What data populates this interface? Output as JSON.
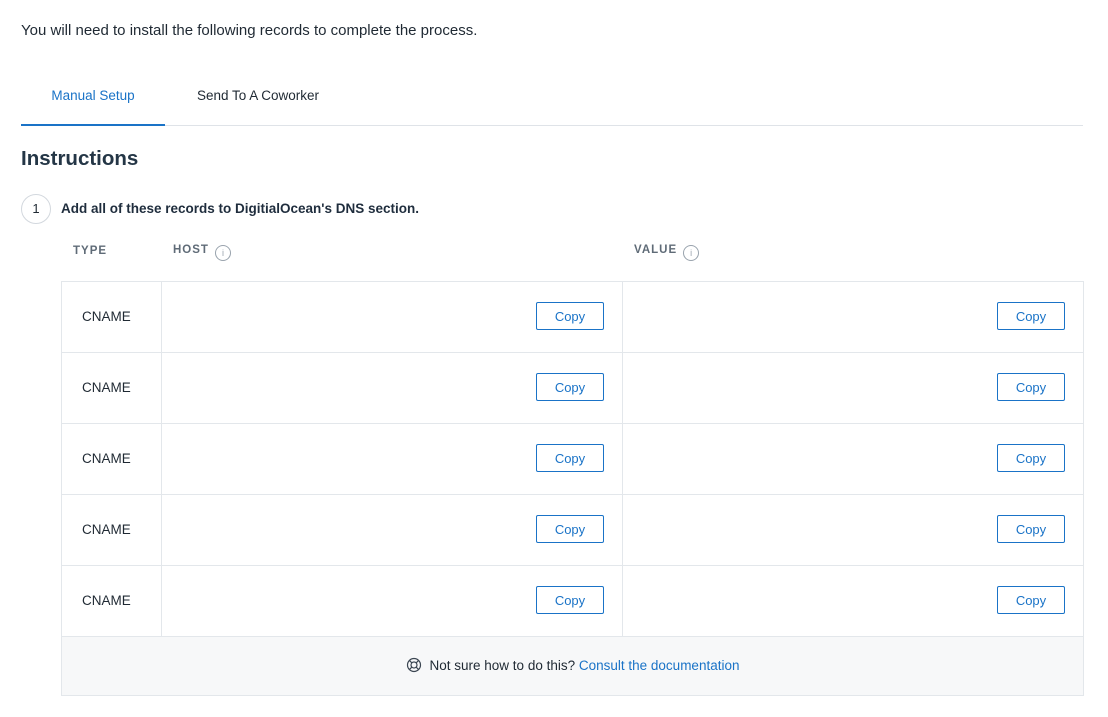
{
  "intro_text": "You will need to install the following records to complete the process.",
  "tabs": [
    {
      "label": "Manual Setup",
      "active": true
    },
    {
      "label": "Send To A Coworker",
      "active": false
    }
  ],
  "section_title": "Instructions",
  "step": {
    "number": "1",
    "text": "Add all of these records to DigitialOcean's DNS section."
  },
  "table": {
    "headers": {
      "type": "TYPE",
      "host": "HOST",
      "value": "VALUE"
    },
    "rows": [
      {
        "type": "CNAME",
        "host": "",
        "value": ""
      },
      {
        "type": "CNAME",
        "host": "",
        "value": ""
      },
      {
        "type": "CNAME",
        "host": "",
        "value": ""
      },
      {
        "type": "CNAME",
        "host": "",
        "value": ""
      },
      {
        "type": "CNAME",
        "host": "",
        "value": ""
      }
    ],
    "copy_label": "Copy"
  },
  "footer": {
    "text": "Not sure how to do this?",
    "link": "Consult the documentation"
  },
  "colors": {
    "accent": "#1a73c7",
    "border": "#e3e7eb",
    "footer_bg": "#f7f8f9"
  },
  "icons": {
    "info": "info-icon",
    "help": "lifebuoy-icon"
  }
}
